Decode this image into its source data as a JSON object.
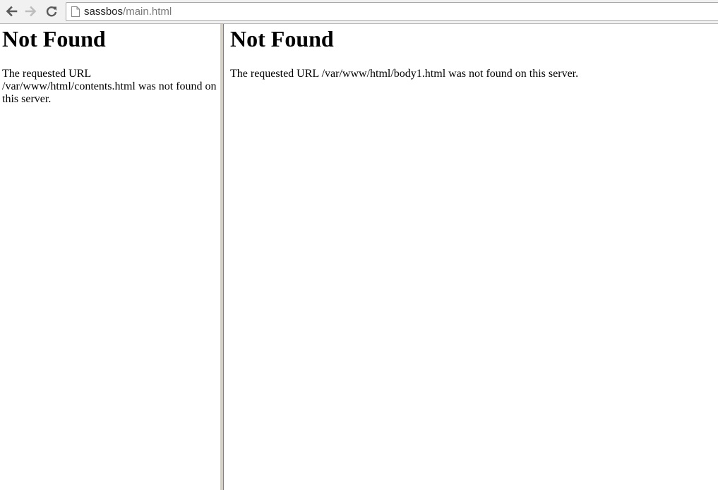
{
  "browser": {
    "url_host": "sassbos",
    "url_path": "/main.html"
  },
  "left_frame": {
    "heading": "Not Found",
    "message": "The requested URL /var/www/html/contents.html was not found on this server."
  },
  "right_frame": {
    "heading": "Not Found",
    "message": "The requested URL /var/www/html/body1.html was not found on this server."
  },
  "icons": {
    "back": "arrow-left-icon",
    "forward": "arrow-right-icon",
    "reload": "reload-icon",
    "page": "page-icon"
  }
}
